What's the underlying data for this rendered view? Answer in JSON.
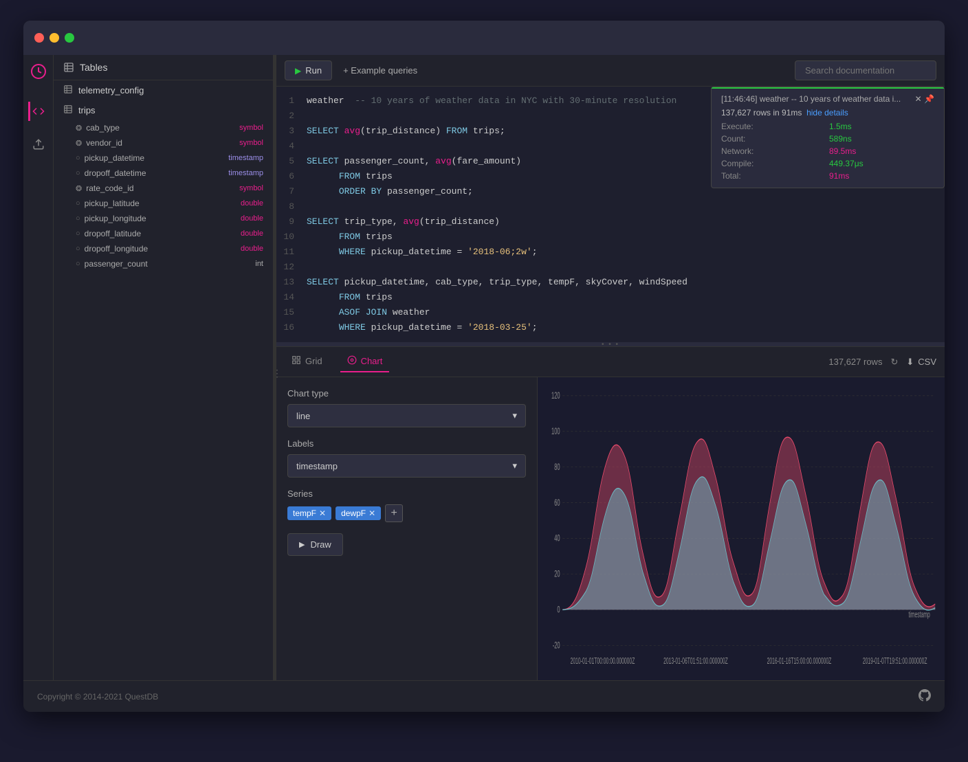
{
  "window": {
    "dots": [
      "red",
      "yellow",
      "green"
    ]
  },
  "toolbar": {
    "run_label": "Run",
    "example_label": "+ Example queries",
    "search_placeholder": "Search documentation"
  },
  "sidebar": {
    "tables_label": "Tables",
    "tables": [
      {
        "name": "telemetry_config",
        "fields": []
      },
      {
        "name": "trips",
        "fields": [
          {
            "name": "cab_type",
            "type": "symbol"
          },
          {
            "name": "vendor_id",
            "type": "symbol"
          },
          {
            "name": "pickup_datetime",
            "type": "timestamp"
          },
          {
            "name": "dropoff_datetime",
            "type": "timestamp"
          },
          {
            "name": "rate_code_id",
            "type": "symbol"
          },
          {
            "name": "pickup_latitude",
            "type": "double"
          },
          {
            "name": "pickup_longitude",
            "type": "double"
          },
          {
            "name": "dropoff_latitude",
            "type": "double"
          },
          {
            "name": "dropoff_longitude",
            "type": "double"
          },
          {
            "name": "passenger_count",
            "type": "int"
          }
        ]
      }
    ]
  },
  "editor": {
    "lines": [
      {
        "num": 1,
        "content": "weather  -- 10 years of weather data in NYC with 30-minute resolution"
      },
      {
        "num": 2,
        "content": ""
      },
      {
        "num": 3,
        "content": "SELECT avg(trip_distance) FROM trips;"
      },
      {
        "num": 4,
        "content": ""
      },
      {
        "num": 5,
        "content": "SELECT passenger_count, avg(fare_amount)"
      },
      {
        "num": 6,
        "content": "    FROM trips"
      },
      {
        "num": 7,
        "content": "    ORDER BY passenger_count;"
      },
      {
        "num": 8,
        "content": ""
      },
      {
        "num": 9,
        "content": "SELECT trip_type, avg(trip_distance)"
      },
      {
        "num": 10,
        "content": "    FROM trips"
      },
      {
        "num": 11,
        "content": "    WHERE pickup_datetime = '2018-06;2w';"
      },
      {
        "num": 12,
        "content": ""
      },
      {
        "num": 13,
        "content": "SELECT pickup_datetime, cab_type, trip_type, tempF, skyCover, windSpeed"
      },
      {
        "num": 14,
        "content": "    FROM trips"
      },
      {
        "num": 15,
        "content": "    ASOF JOIN weather"
      },
      {
        "num": 16,
        "content": "    WHERE pickup_datetime = '2018-03-25';"
      }
    ]
  },
  "notification": {
    "header": "[11:46:46] weather -- 10 years of weather data i...",
    "rows_info": "137,627 rows in 91ms",
    "hide_label": "hide details",
    "execute_label": "Execute:",
    "execute_value": "1.5ms",
    "count_label": "Count:",
    "count_value": "589ns",
    "network_label": "Network:",
    "network_value": "89.5ms",
    "compile_label": "Compile:",
    "compile_value": "449.37μs",
    "total_label": "Total:",
    "total_value": "91ms"
  },
  "results": {
    "tabs": [
      {
        "id": "grid",
        "label": "Grid"
      },
      {
        "id": "chart",
        "label": "Chart"
      }
    ],
    "rows_count": "137,627 rows",
    "csv_label": "CSV",
    "active_tab": "chart"
  },
  "chart": {
    "type_label": "Chart type",
    "type_value": "line",
    "labels_label": "Labels",
    "labels_value": "timestamp",
    "series_label": "Series",
    "series_tags": [
      "tempF",
      "dewpF"
    ],
    "draw_label": "Draw",
    "y_axis_values": [
      120,
      100,
      80,
      60,
      40,
      20,
      0,
      -20
    ],
    "x_axis_values": [
      "2010-01-01T00:00:00.000000Z",
      "2013-01-06T01:51:00.000000Z",
      "2016-01-16T15:00:00.000000Z",
      "2019-01-07T19:51:00.000000Z"
    ],
    "x_label": "timestamp"
  },
  "footer": {
    "copyright": "Copyright © 2014-2021 QuestDB"
  }
}
